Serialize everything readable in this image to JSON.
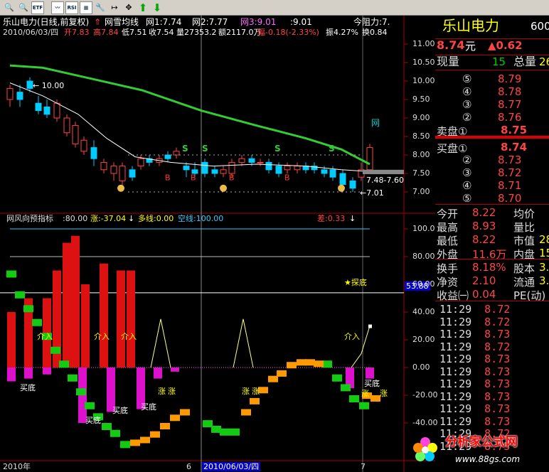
{
  "toolbar": {
    "icons": [
      "magnifier-icon",
      "zoom-icon",
      "etf-icon",
      "chart-icon",
      "rsi-icon",
      "grid-icon",
      "tool-icon",
      "export-icon",
      "move-icon",
      "arrow-up-icon",
      "arrow-down-icon"
    ],
    "etf_label": "ETF",
    "rsi_label": "RSI"
  },
  "main": {
    "title": "乐山电力(日线,前复权)",
    "indicator_name": "网雪均线",
    "net1": "网1:7.74",
    "net2": "网2:7.77",
    "net3": "网3:9.01",
    "net4": ":9.01",
    "resistance": "今阻力:7.",
    "date": "2010/06/03/四",
    "open": "开7.83",
    "high": "高7.84",
    "low": "低7.51",
    "close": "收7.54",
    "volume": "量27353.2",
    "amount": "额2117.0万",
    "change": "幅-0.18(-2.33%)",
    "amplitude": "振4.27%",
    "turnover": "换0.84",
    "high_label": "10.00",
    "range_label": "7.48-7.60",
    "low_label": "7.01",
    "net_label": "网",
    "y_ticks": [
      "11.00",
      "10.50",
      "10.00",
      "9.50",
      "9.00",
      "8.50",
      "8.00",
      "7.50",
      "7.00"
    ]
  },
  "sub": {
    "title": "网风向预指标",
    "period": ":80.00",
    "rise": "涨:-37.04",
    "multi": "多线:0.00",
    "empty": "空线:100.00",
    "diff": "差:0.33",
    "y_ticks": [
      "100.0",
      "80.00",
      "60.00",
      "40.00",
      "20.00",
      "0.00",
      "-20.00",
      "-40.00"
    ],
    "highlight_value": "53.88",
    "probe_label": "★探底",
    "jieru": "介入",
    "maidi": "买底",
    "zhang": "涨",
    "x_left": "2010年",
    "x_mid": "6",
    "x_date": "2010/06/03/四",
    "x_right": "7"
  },
  "quote": {
    "name": "乐山电力",
    "code": "600",
    "price": "8.74",
    "price_unit": "元",
    "change": "▲0.62",
    "current_volume_label": "现量",
    "current_volume": "15",
    "total_volume_label": "总量",
    "total_volume": "26",
    "sell_label": "卖盘①",
    "buy_label": "买盘①",
    "sell_prices": [
      "8.79",
      "8.78",
      "8.77",
      "8.76"
    ],
    "sell_marks": [
      "⑤",
      "④",
      "③",
      "②"
    ],
    "sell1": "8.75",
    "buy1": "8.74",
    "buy_prices": [
      "8.73",
      "8.72",
      "8.71",
      "8.70"
    ],
    "buy_marks": [
      "②",
      "③",
      "④",
      "⑤"
    ],
    "stats": [
      {
        "a": "今开",
        "av": "8.22",
        "b": "均价",
        "bv": ""
      },
      {
        "a": "最高",
        "av": "8.93",
        "b": "量比",
        "bv": ""
      },
      {
        "a": "最低",
        "av": "8.22",
        "b": "市值",
        "bv": "28"
      },
      {
        "a": "外盘",
        "av": "11.6万",
        "b": "内盘",
        "bv": "15"
      }
    ],
    "fund": [
      {
        "a": "换手",
        "av": "8.18%",
        "b": "股本",
        "bv": "3."
      },
      {
        "a": "净资",
        "av": "2.10",
        "b": "流通",
        "bv": "3."
      },
      {
        "a": "收益㈠",
        "av": "0.04",
        "b": "PE(动)",
        "bv": ""
      }
    ],
    "trades": [
      {
        "t": "11:29",
        "p": "8.72"
      },
      {
        "t": "11:29",
        "p": "8.72"
      },
      {
        "t": "11:29",
        "p": "8.73"
      },
      {
        "t": "11:29",
        "p": "8.72"
      },
      {
        "t": "11:29",
        "p": "8.73"
      },
      {
        "t": "11:29",
        "p": "8.73"
      },
      {
        "t": "11:29",
        "p": "8.73"
      },
      {
        "t": "11:29",
        "p": "8.73"
      },
      {
        "t": "11:29",
        "p": "8.73"
      },
      {
        "t": "11:29",
        "p": "8.73"
      },
      {
        "t": "11:29",
        "p": "8.72"
      },
      {
        "t": "11:29",
        "p": "8.73"
      }
    ]
  },
  "watermark": {
    "text": "分析家公式网",
    "url": "www.88gs.com"
  }
}
